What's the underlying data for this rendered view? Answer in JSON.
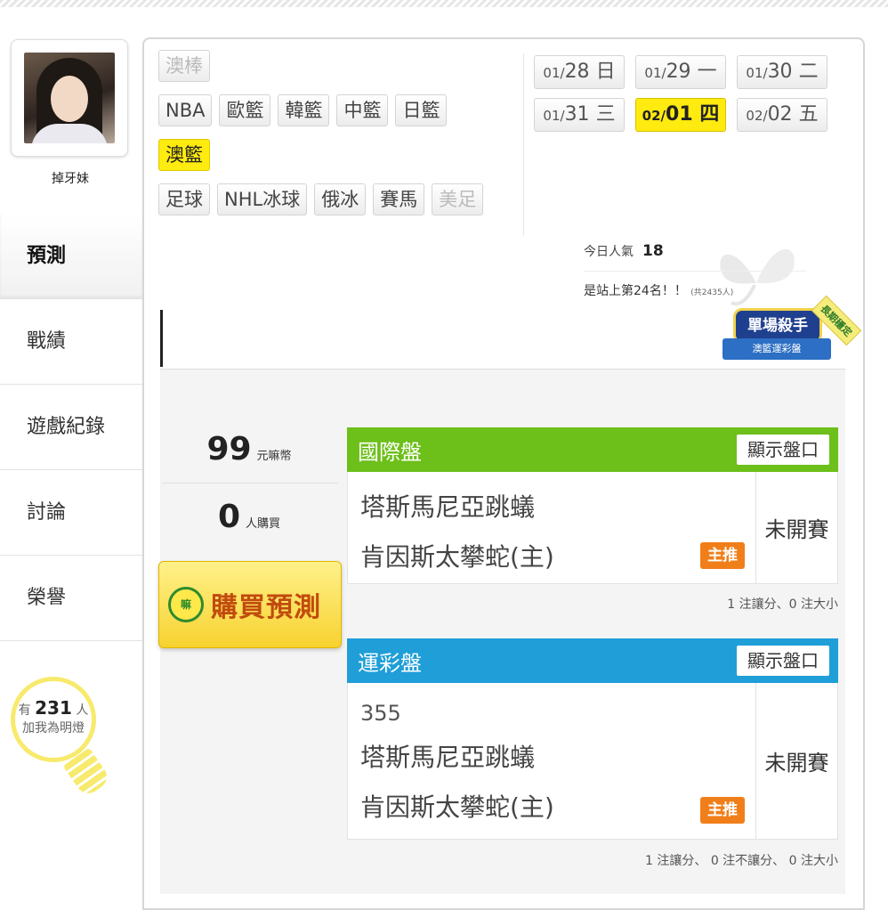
{
  "user": {
    "name": "掉牙妹"
  },
  "sidebar": {
    "items": [
      {
        "label": "預測"
      },
      {
        "label": "戰績"
      },
      {
        "label": "遊戲紀錄"
      },
      {
        "label": "討論"
      },
      {
        "label": "榮譽"
      }
    ]
  },
  "fans": {
    "prefix": "有",
    "count": "231",
    "unit": "人",
    "suffix": "加我為明燈"
  },
  "categories": {
    "row1": [
      "澳棒"
    ],
    "row2": [
      "NBA",
      "歐籃",
      "韓籃",
      "中籃",
      "日籃"
    ],
    "row3": [
      "澳籃"
    ],
    "row4": [
      "足球",
      "NHL冰球",
      "俄冰",
      "賽馬",
      "美足"
    ]
  },
  "dates": [
    {
      "m": "01/",
      "d": "28",
      "w": "日"
    },
    {
      "m": "01/",
      "d": "29",
      "w": "一"
    },
    {
      "m": "01/",
      "d": "30",
      "w": "二"
    },
    {
      "m": "01/",
      "d": "31",
      "w": "三"
    },
    {
      "m": "02/",
      "d": "01",
      "w": "四"
    },
    {
      "m": "02/",
      "d": "02",
      "w": "五"
    }
  ],
  "popularity": {
    "label": "今日人氣",
    "value": "18"
  },
  "rank": {
    "text": "是站上第24名！！",
    "total": "(共2435人)"
  },
  "badge": {
    "title": "單場殺手",
    "subtitle": "澳籃運彩盤",
    "tag": "長期穩定"
  },
  "stats": {
    "price": "99",
    "price_unit": "元嘛幣",
    "buyers": "0",
    "buyers_unit": "人購買"
  },
  "buy": {
    "icon_text": "嘛",
    "label": "購買預測"
  },
  "markets": [
    {
      "title": "國際盤",
      "show_label": "顯示盤口",
      "away": "塔斯馬尼亞跳蟻",
      "home": "肯因斯太攀蛇(主)",
      "status": "未開賽",
      "tag": "主推",
      "note": "1 注讓分、0 注大小",
      "color": "#6dbf1a"
    },
    {
      "title": "運彩盤",
      "show_label": "顯示盤口",
      "code": "355",
      "away": "塔斯馬尼亞跳蟻",
      "home": "肯因斯太攀蛇(主)",
      "status": "未開賽",
      "tag": "主推",
      "note": "1 注讓分、 0 注不讓分、 0 注大小",
      "color": "#1f9ed8"
    }
  ]
}
